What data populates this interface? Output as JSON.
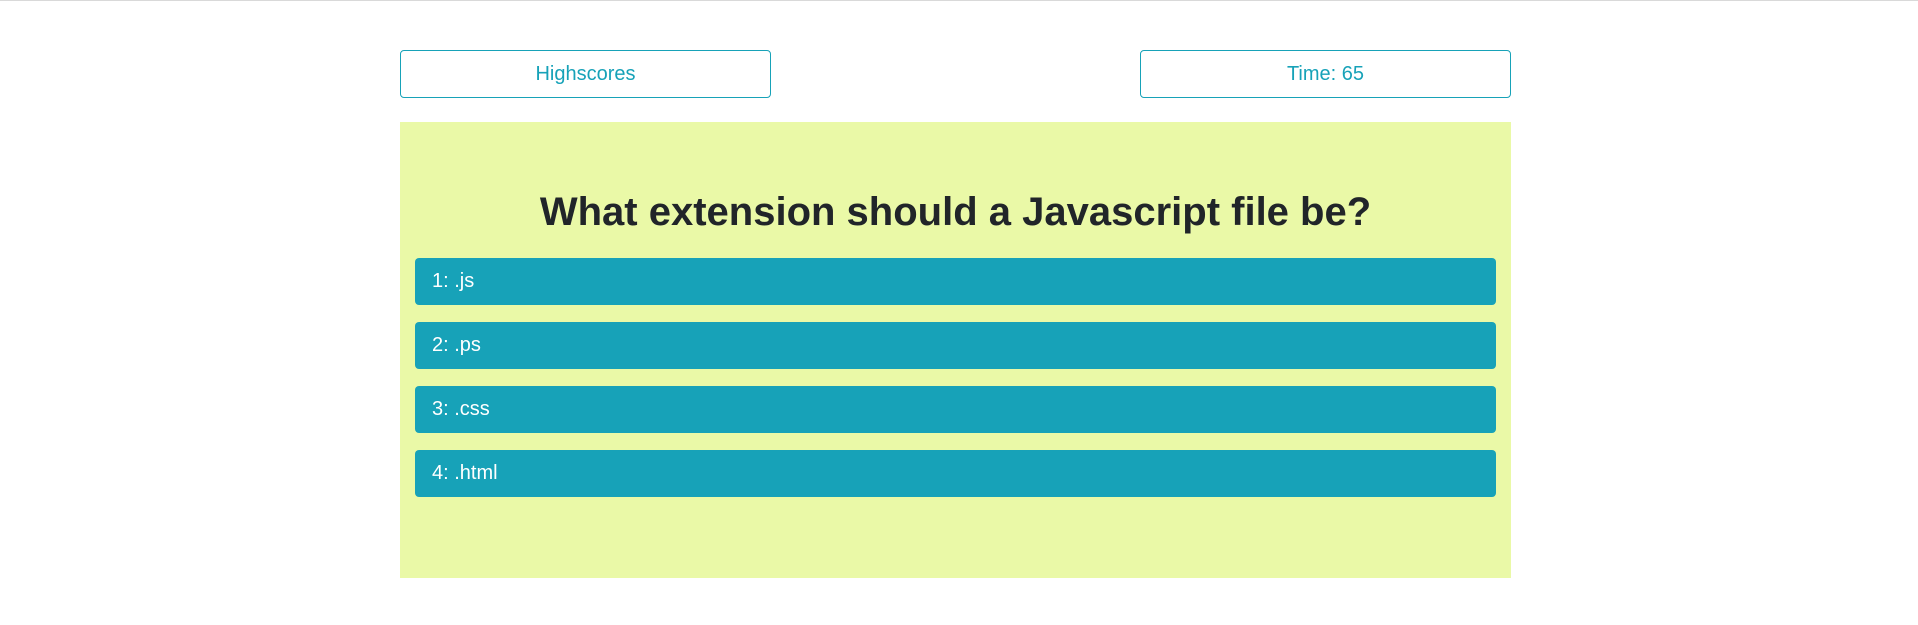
{
  "header": {
    "highscores_label": "Highscores",
    "time_label": "Time:",
    "time_value": "65"
  },
  "quiz": {
    "question": "What extension should a Javascript file be?",
    "answers": [
      {
        "number": "1:",
        "text": ".js"
      },
      {
        "number": "2:",
        "text": ".ps"
      },
      {
        "number": "3:",
        "text": ".css"
      },
      {
        "number": "4:",
        "text": ".html"
      }
    ]
  },
  "colors": {
    "accent": "#17a2b8",
    "card_background": "#eaf9a7",
    "heading_text": "#212529"
  }
}
